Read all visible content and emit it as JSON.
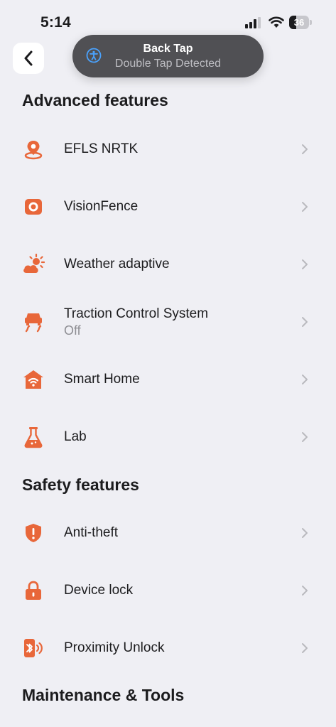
{
  "status_bar": {
    "time": "5:14",
    "battery_level": "36",
    "battery_fraction": 0.36
  },
  "toast": {
    "title": "Back Tap",
    "subtitle": "Double Tap Detected",
    "icon": "accessibility-icon"
  },
  "accent_color": "#e8673a",
  "sections": {
    "advanced": {
      "title": "Advanced features",
      "items": [
        {
          "label": "EFLS NRTK",
          "icon": "location-pin-icon"
        },
        {
          "label": "VisionFence",
          "icon": "camera-lens-icon"
        },
        {
          "label": "Weather adaptive",
          "icon": "sun-cloud-icon"
        },
        {
          "label": "Traction Control System",
          "sublabel": "Off",
          "icon": "traction-icon"
        },
        {
          "label": "Smart Home",
          "icon": "home-wifi-icon"
        },
        {
          "label": "Lab",
          "icon": "flask-icon"
        }
      ]
    },
    "safety": {
      "title": "Safety features",
      "items": [
        {
          "label": "Anti-theft",
          "icon": "shield-alert-icon"
        },
        {
          "label": "Device lock",
          "icon": "lock-icon"
        },
        {
          "label": "Proximity Unlock",
          "icon": "bluetooth-unlock-icon"
        }
      ]
    },
    "maintenance": {
      "title": "Maintenance & Tools"
    }
  }
}
